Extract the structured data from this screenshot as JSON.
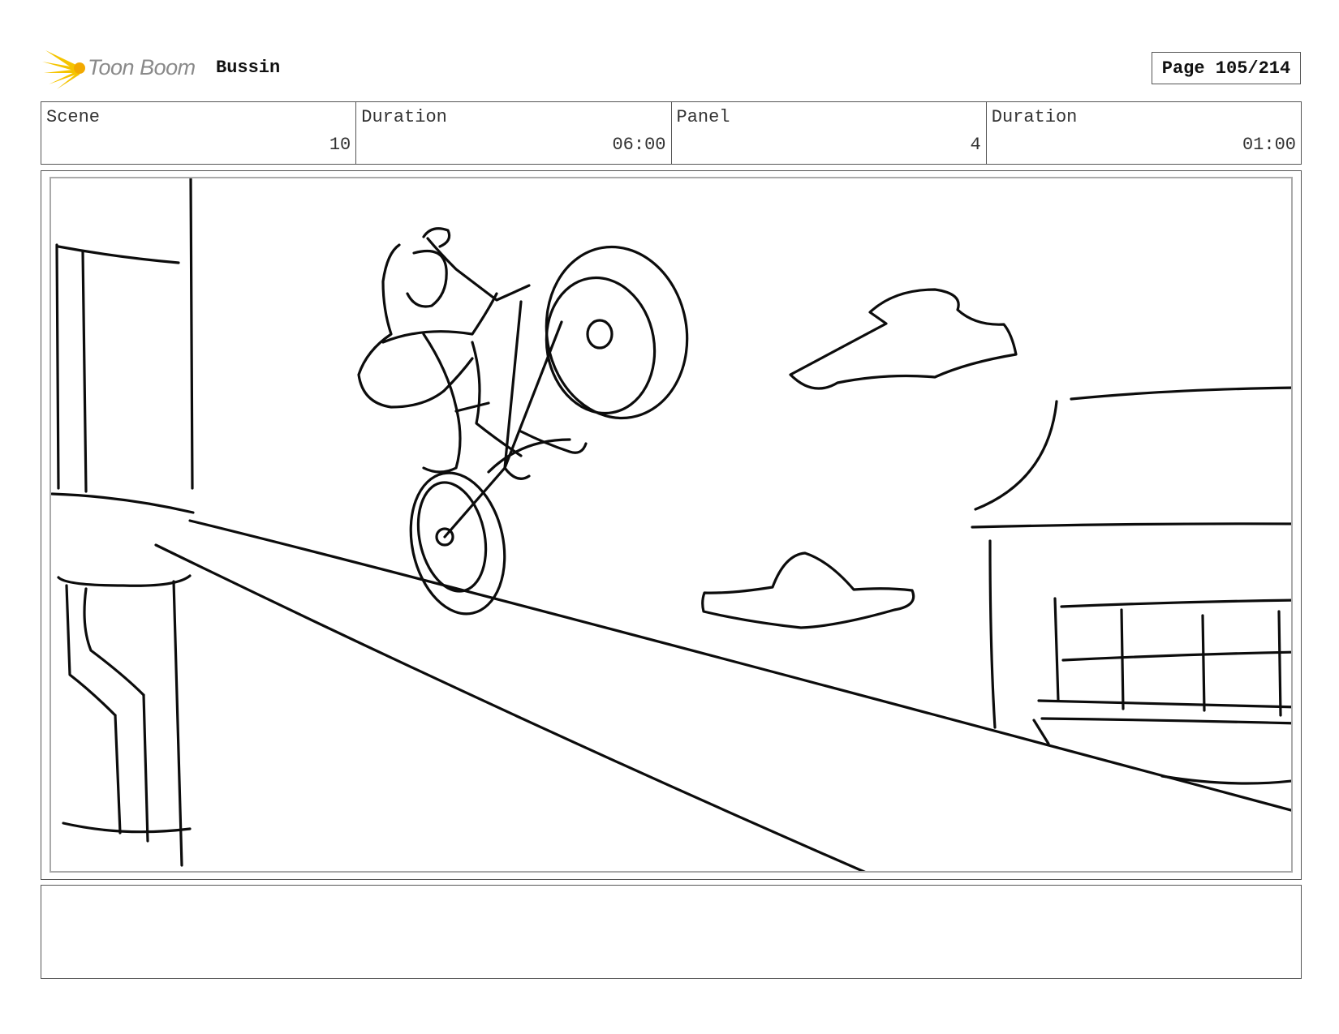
{
  "header": {
    "logo_text": "Toon Boom",
    "project_title": "Bussin",
    "page_label": "Page 105/214"
  },
  "info": {
    "scene_label": "Scene",
    "scene_value": "10",
    "scene_duration_label": "Duration",
    "scene_duration_value": "06:00",
    "panel_label": "Panel",
    "panel_value": "4",
    "panel_duration_label": "Duration",
    "panel_duration_value": "01:00"
  },
  "notes": {
    "text": ""
  },
  "icons": {
    "logo": "toon-boom-starburst-icon"
  }
}
